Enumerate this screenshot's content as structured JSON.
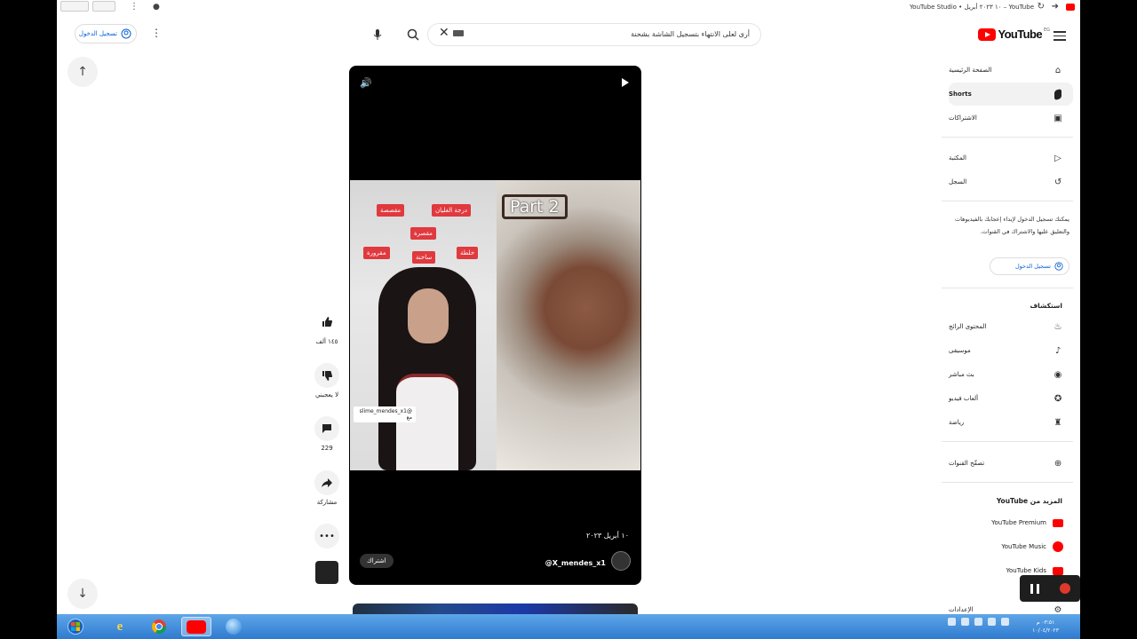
{
  "browser": {
    "title_text": "YouTube – ١٠ ٢٠٢٣ أبريل • YouTube Studio"
  },
  "masthead": {
    "search_query": "أرى لعلى الانتهاء بتسجيل الشاشة بشحنة",
    "signin_label": "تسجيل الدخول",
    "logo_text": "YouTube",
    "logo_country": "EG"
  },
  "video": {
    "part_label": "Part 2",
    "stickers": [
      "مقصصة",
      "درجة الغليان",
      "مقصرة",
      "خلطة",
      "ساخنة",
      "مقرورة"
    ],
    "mention_tag": "@slime_mendes_x1 مع",
    "date": "١٠ أبريل ٢٠٢٣",
    "channel_handle": "@X_mendes_x1",
    "subscribe_label": "اشتراك"
  },
  "actions": {
    "like_count": "١٤٥ ألف",
    "dislike_label": "لا يعجبني",
    "comment_count": "229",
    "share_label": "مشاركة"
  },
  "sidebar": {
    "main": [
      {
        "label": "الصفحة الرئيسية",
        "icon": "home-icon"
      },
      {
        "label": "Shorts",
        "icon": "shorts-icon"
      },
      {
        "label": "الاشتراكات",
        "icon": "subscriptions-icon"
      }
    ],
    "library": [
      {
        "label": "المكتبة",
        "icon": "library-icon"
      },
      {
        "label": "السجل",
        "icon": "history-icon"
      }
    ],
    "signin_prompt": "يمكنك تسجيل الدخول لإبداء إعجابك بالفيديوهات والتعليق عليها والاشتراك في القنوات.",
    "signin_button": "تسجيل الدخول",
    "explore_heading": "استكشاف",
    "explore": [
      {
        "label": "المحتوى الرائج",
        "icon": "trending-icon"
      },
      {
        "label": "موسيقى",
        "icon": "music-icon"
      },
      {
        "label": "بث مباشر",
        "icon": "live-icon"
      },
      {
        "label": "ألعاب فيديو",
        "icon": "gaming-icon"
      },
      {
        "label": "رياضة",
        "icon": "sports-icon"
      }
    ],
    "browse_channels": "تصفّح القنوات",
    "more_heading": "المزيد من YouTube",
    "more": [
      {
        "label": "YouTube Premium"
      },
      {
        "label": "YouTube Music"
      },
      {
        "label": "YouTube Kids"
      }
    ],
    "settings_label": "الإعدادات"
  },
  "taskbar": {
    "time": "٠٣:٥١ م",
    "date": "١٠/٠٤/٢٠٢٣"
  },
  "colors": {
    "brand_red": "#ff0000",
    "link_blue": "#065fd4",
    "taskbar_blue": "#2f7ad0"
  }
}
